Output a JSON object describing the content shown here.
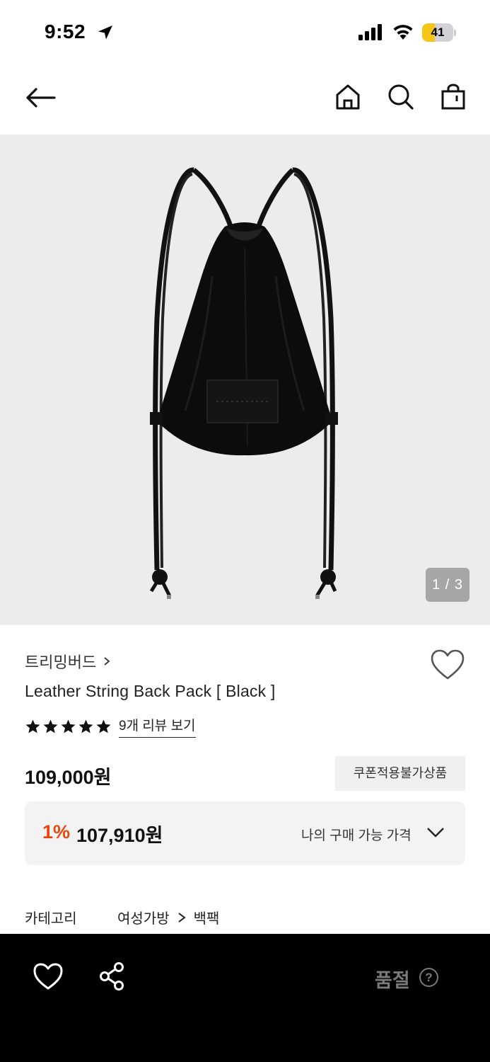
{
  "status_bar": {
    "time": "9:52",
    "battery": "41",
    "battery_level": 0.41
  },
  "product": {
    "image_counter": "1 / 3",
    "brand": "트리밍버드",
    "name": "Leather String Back Pack [ Black ]",
    "rating_stars": 5,
    "review_link": "9개 리뷰 보기",
    "price": "109,000원",
    "coupon_badge": "쿠폰적용불가상품",
    "discount_rate": "1%",
    "my_price": "107,910원",
    "my_price_label": "나의 구매 가능 가격"
  },
  "category": {
    "label": "카테고리",
    "path": [
      "여성가방",
      "백팩"
    ]
  },
  "bottom_bar": {
    "soldout_label": "품절",
    "help_glyph": "?"
  },
  "icons": [
    "location-arrow-icon",
    "signal-icon",
    "wifi-icon",
    "battery-icon",
    "back-arrow-icon",
    "home-icon",
    "search-icon",
    "shopping-bag-icon",
    "chevron-right-icon",
    "heart-outline-icon",
    "star-icon",
    "chevron-down-icon",
    "share-icon",
    "help-icon"
  ],
  "colors": {
    "accent_discount": "#e8460c",
    "bottom_bar": "#000000",
    "soldout_text": "#7a7a7a",
    "battery_fill": "#f5c518"
  }
}
